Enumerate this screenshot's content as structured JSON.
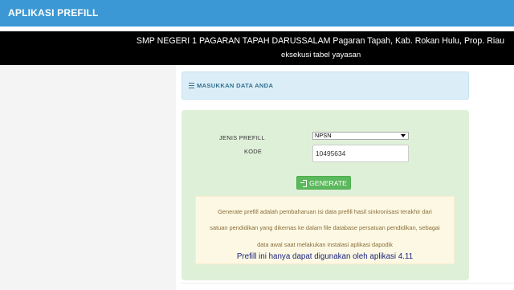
{
  "app": {
    "title": "APLIKASI PREFILL"
  },
  "header": {
    "school": "SMP NEGERI 1 PAGARAN TAPAH DARUSSALAM Pagaran Tapah, Kab. Rokan Hulu, Prop. Riau",
    "subtitle": "eksekusi tabel yayasan"
  },
  "info_panel": {
    "label": "MASUKKAN DATA ANDA",
    "icon": "list-icon"
  },
  "form": {
    "jenis_label": "JENIS PREFILL",
    "jenis_value": "NPSN",
    "kode_label": "KODE",
    "kode_value": "10495634",
    "generate_label": "GENERATE",
    "generate_icon": "sign-in-icon"
  },
  "warning": {
    "line1": "Generate prefill adalah pembaharuan isi data prefill hasil sinkronisasi terakhir dari",
    "line2": "satuan pendidikan yang dikemas ke dalam file database persatuan pendidikan, sebagai",
    "line3": "data awal saat melakukan instalasi aplikasi dapodik",
    "note": "Prefill ini hanya dapat digunakan oleh aplikasi 4.11"
  },
  "colors": {
    "topbar": "#3b98d4",
    "info_bg": "#dbeef8",
    "form_bg": "#dff0d8",
    "button": "#5cb85c",
    "warning_bg": "#fcf8e3"
  }
}
